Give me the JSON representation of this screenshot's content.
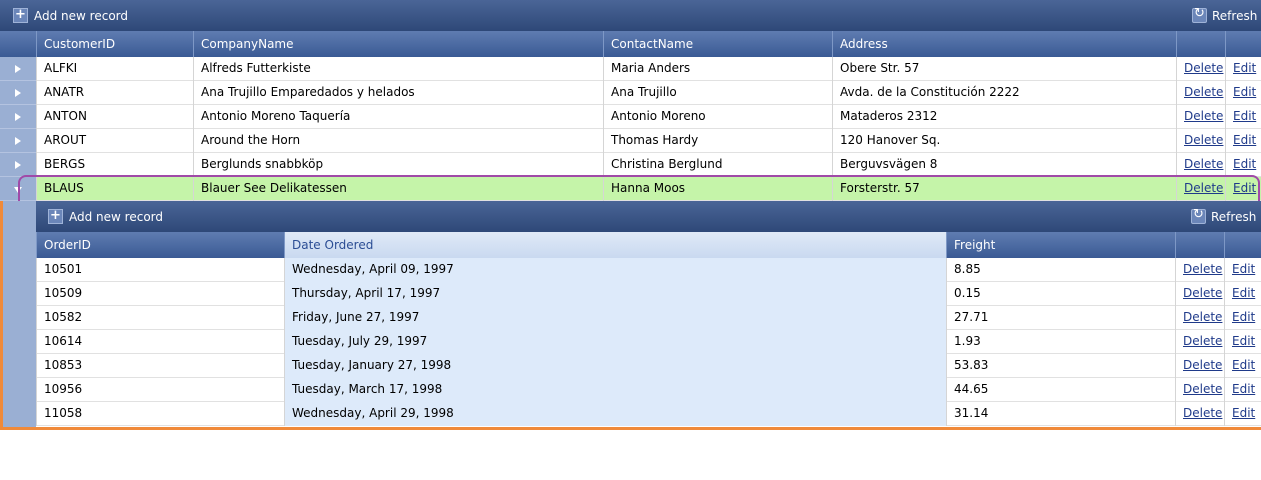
{
  "master": {
    "add_label": "Add new record",
    "refresh_label": "Refresh",
    "columns": [
      "CustomerID",
      "CompanyName",
      "ContactName",
      "Address"
    ],
    "delete_label": "Delete",
    "edit_label": "Edit",
    "rows": [
      {
        "id": "ALFKI",
        "company": "Alfreds Futterkiste",
        "contact": "Maria Anders",
        "address": "Obere Str. 57"
      },
      {
        "id": "ANATR",
        "company": "Ana Trujillo Emparedados y helados",
        "contact": "Ana Trujillo",
        "address": "Avda. de la Constitución 2222"
      },
      {
        "id": "ANTON",
        "company": "Antonio Moreno Taquería",
        "contact": "Antonio Moreno",
        "address": "Mataderos 2312"
      },
      {
        "id": "AROUT",
        "company": "Around the Horn",
        "contact": "Thomas Hardy",
        "address": "120 Hanover Sq."
      },
      {
        "id": "BERGS",
        "company": "Berglunds snabbköp",
        "contact": "Christina Berglund",
        "address": "Berguvsvägen 8"
      },
      {
        "id": "BLAUS",
        "company": "Blauer See Delikatessen",
        "contact": "Hanna Moos",
        "address": "Forsterstr. 57"
      }
    ]
  },
  "detail": {
    "add_label": "Add new record",
    "refresh_label": "Refresh",
    "columns": [
      "OrderID",
      "Date Ordered",
      "Freight"
    ],
    "delete_label": "Delete",
    "edit_label": "Edit",
    "rows": [
      {
        "order": "10501",
        "date": "Wednesday, April 09, 1997",
        "freight": "8.85"
      },
      {
        "order": "10509",
        "date": "Thursday, April 17, 1997",
        "freight": "0.15"
      },
      {
        "order": "10582",
        "date": "Friday, June 27, 1997",
        "freight": "27.71"
      },
      {
        "order": "10614",
        "date": "Tuesday, July 29, 1997",
        "freight": "1.93"
      },
      {
        "order": "10853",
        "date": "Tuesday, January 27, 1998",
        "freight": "53.83"
      },
      {
        "order": "10956",
        "date": "Tuesday, March 17, 1998",
        "freight": "44.65"
      },
      {
        "order": "11058",
        "date": "Wednesday, April 29, 1998",
        "freight": "31.14"
      }
    ]
  },
  "colors": {
    "header": "#3a5a94",
    "selected_row": "#c5f4a9",
    "sorted_column": "#ddeafa",
    "selection_outline": "#a04aa8",
    "accent_border": "#f08a3a"
  }
}
